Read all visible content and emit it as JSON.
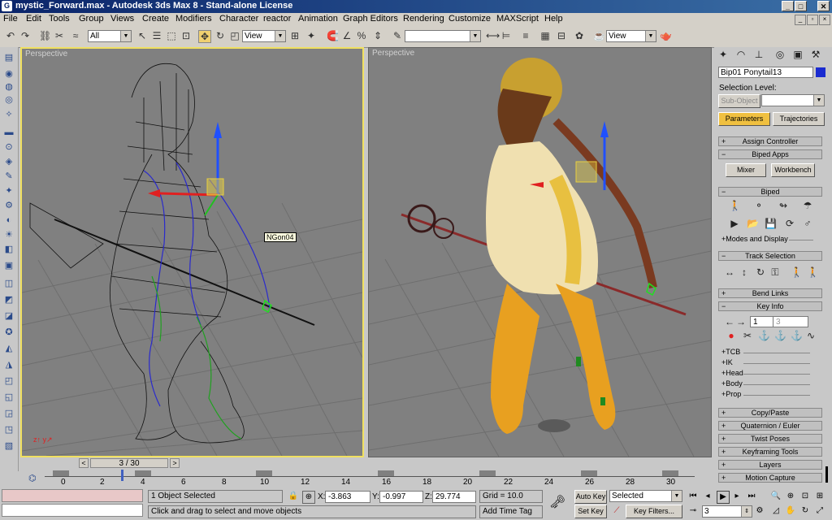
{
  "window": {
    "title": "mystic_Forward.max - Autodesk 3ds Max 8 - Stand-alone License",
    "minimize": "_",
    "maximize": "□",
    "close": "✕"
  },
  "menu": [
    "File",
    "Edit",
    "Tools",
    "Group",
    "Views",
    "Create",
    "Modifiers",
    "Character",
    "reactor",
    "Animation",
    "Graph Editors",
    "Rendering",
    "Customize",
    "MAXScript",
    "Help"
  ],
  "toolbar": {
    "selection_filter": "All",
    "ref_coord": "View",
    "named_selection": "",
    "render_view": "View"
  },
  "viewports": {
    "left_label": "Perspective",
    "right_label": "Perspective",
    "object_tag": "NGon04"
  },
  "command_panel": {
    "object_name": "Bip01 Ponytail13",
    "object_color": "#1a2bd0",
    "selection_level_label": "Selection Level:",
    "sub_object": "Sub-Object",
    "tabs": {
      "parameters": "Parameters",
      "trajectories": "Trajectories"
    },
    "rollouts": {
      "assign_controller": "Assign Controller",
      "biped_apps": "Biped Apps",
      "mixer": "Mixer",
      "workbench": "Workbench",
      "biped": "Biped",
      "modes_display": "+Modes and Display",
      "track_selection": "Track Selection",
      "bend_links": "Bend Links",
      "key_info": "Key Info",
      "key_value": "1",
      "key_value2": "3",
      "tcb": "+TCB",
      "ik": "+IK",
      "head": "+Head",
      "body": "+Body",
      "prop": "+Prop",
      "copy_paste": "Copy/Paste",
      "quaternion_euler": "Quaternion / Euler",
      "twist_poses": "Twist Poses",
      "keyframing_tools": "Keyframing Tools",
      "layers": "Layers",
      "motion_capture": "Motion Capture"
    }
  },
  "timeline": {
    "frame_indicator": "3 / 30",
    "prev": "<",
    "next": ">",
    "ticks": [
      "0",
      "2",
      "4",
      "6",
      "8",
      "10",
      "12",
      "14",
      "16",
      "18",
      "20",
      "22",
      "24",
      "26",
      "28",
      "30"
    ]
  },
  "status": {
    "objects_selected": "1 Object Selected",
    "prompt": "Click and drag to select and move objects",
    "x_label": "X:",
    "x_value": "-3.863",
    "y_label": "Y:",
    "y_value": "-0.997",
    "z_label": "Z:",
    "z_value": "29.774",
    "grid": "Grid = 10.0",
    "add_time_tag": "Add Time Tag",
    "auto_key": "Auto Key",
    "set_key": "Set Key",
    "key_mode": "Selected",
    "key_filters": "Key Filters...",
    "current_frame": "3"
  },
  "colors": {
    "accent": "#f0c040",
    "viewport_bg": "#808080",
    "active_border": "#f0e060"
  }
}
